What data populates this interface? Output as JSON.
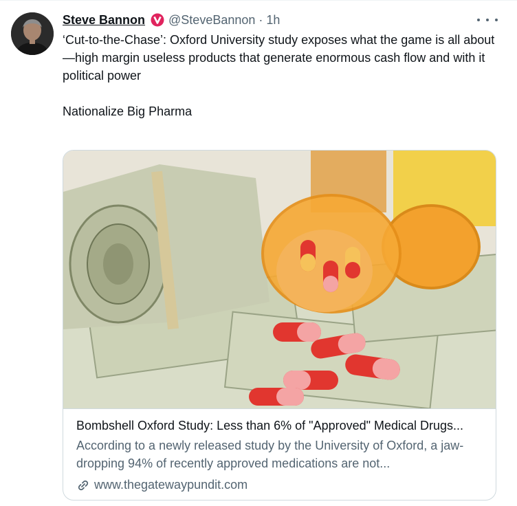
{
  "author": {
    "name": "Steve Bannon",
    "handle": "@SteveBannon",
    "separator": "·",
    "time": "1h",
    "badge_icon": "verified-v-badge-icon",
    "badge_color": "#e0245e"
  },
  "tweet": {
    "text_lines": [
      "‘Cut-to-the-Chase’: Oxford University study exposes what the game is all about—high margin useless products that generate enormous cash flow and with it political power",
      "Nationalize Big Pharma"
    ]
  },
  "card": {
    "image_alt": "rolled dollar bills and spilled prescription pill bottles with red capsules",
    "title": "Bombshell Oxford Study: Less than 6% of \"Approved\" Medical Drugs...",
    "description": "According to a newly released study by the University of Oxford, a jaw-dropping 94% of recently approved medications are not...",
    "domain": "www.thegatewaypundit.com",
    "link_icon": "link-icon"
  },
  "colors": {
    "text": "#0f1419",
    "secondary": "#536471",
    "border": "#cfd9de"
  }
}
